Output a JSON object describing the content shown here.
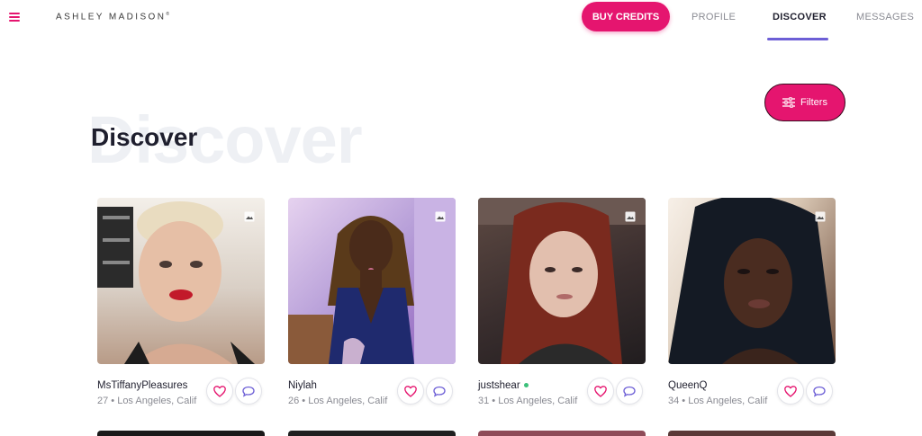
{
  "header": {
    "logo": "ASHLEY MADISON",
    "logo_mark": "®",
    "buy_credits": "BUY CREDITS",
    "nav": {
      "profile": "PROFILE",
      "discover": "DISCOVER",
      "messages": "MESSAGES"
    },
    "active_tab": "discover"
  },
  "main": {
    "title": "Discover",
    "title_background": "Discover",
    "filters_label": "Filters"
  },
  "cards": [
    {
      "name": "MsTiffanyPleasures",
      "location": "27 • Los Angeles, Calif",
      "online": false
    },
    {
      "name": "Niylah",
      "location": "26 • Los Angeles, Calif",
      "online": false
    },
    {
      "name": "justshear",
      "location": "31 • Los Angeles, Calif",
      "online": true
    },
    {
      "name": "QueenQ",
      "location": "34 • Los Angeles, Calif",
      "online": false
    }
  ],
  "colors": {
    "brand": "#e5156f",
    "accent": "#6d5fd6",
    "online": "#3cc07a"
  },
  "icons": {
    "menu": "hamburger-menu-icon",
    "filters": "sliders-icon",
    "like": "heart-icon",
    "message": "chat-bubble-icon",
    "gallery": "image-gallery-icon"
  }
}
